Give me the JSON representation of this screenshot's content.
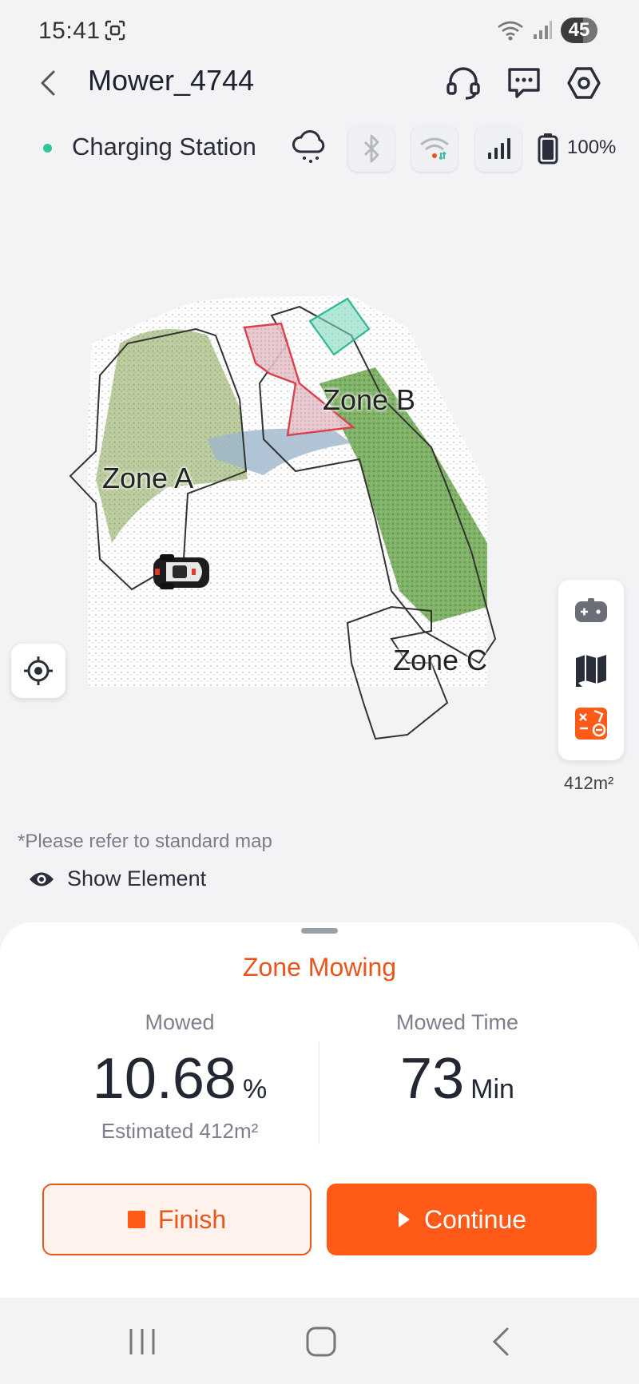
{
  "status_bar": {
    "time": "15:41",
    "battery_level": "45"
  },
  "header": {
    "title": "Mower_4744"
  },
  "device": {
    "location": "Charging Station",
    "battery": "100%",
    "online_color": "#2fc49b"
  },
  "map": {
    "zones": [
      "Zone A",
      "Zone B",
      "Zone C"
    ],
    "area": "412m²",
    "note": "*Please refer to standard map",
    "show_element": "Show Element"
  },
  "session": {
    "mode": "Zone Mowing",
    "mowed_label": "Mowed",
    "mowed_value": "10.68",
    "mowed_unit": "%",
    "estimated": "Estimated 412m²",
    "time_label": "Mowed Time",
    "time_value": "73",
    "time_unit": "Min"
  },
  "actions": {
    "finish": "Finish",
    "continue": "Continue"
  },
  "colors": {
    "accent": "#ff5a17",
    "accent_text": "#e8561c"
  }
}
